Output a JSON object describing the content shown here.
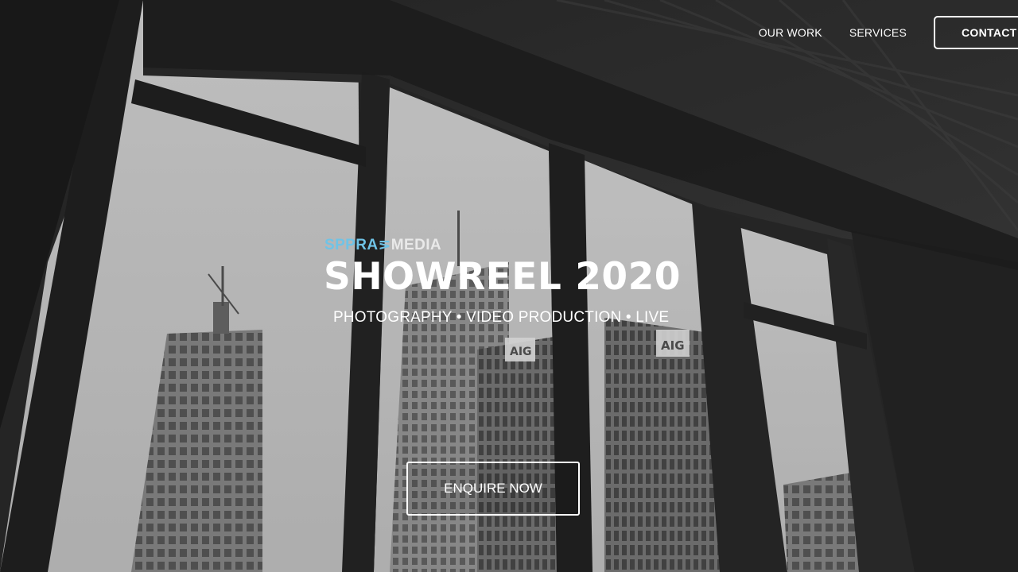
{
  "nav": {
    "items": [
      {
        "label": "OUR WORK"
      },
      {
        "label": "SERVICES"
      }
    ],
    "contact_label": "CONTACT"
  },
  "hero": {
    "brand_part1": "SPPRA",
    "brand_part2": "MEDIA",
    "title": "SHOWREEL 2020",
    "subtitle": "PHOTOGRAPHY • VIDEO PRODUCTION • LIVE",
    "cta_label": "ENQUIRE NOW"
  },
  "colors": {
    "brand_accent": "#6fc3e6",
    "text": "#ffffff"
  }
}
